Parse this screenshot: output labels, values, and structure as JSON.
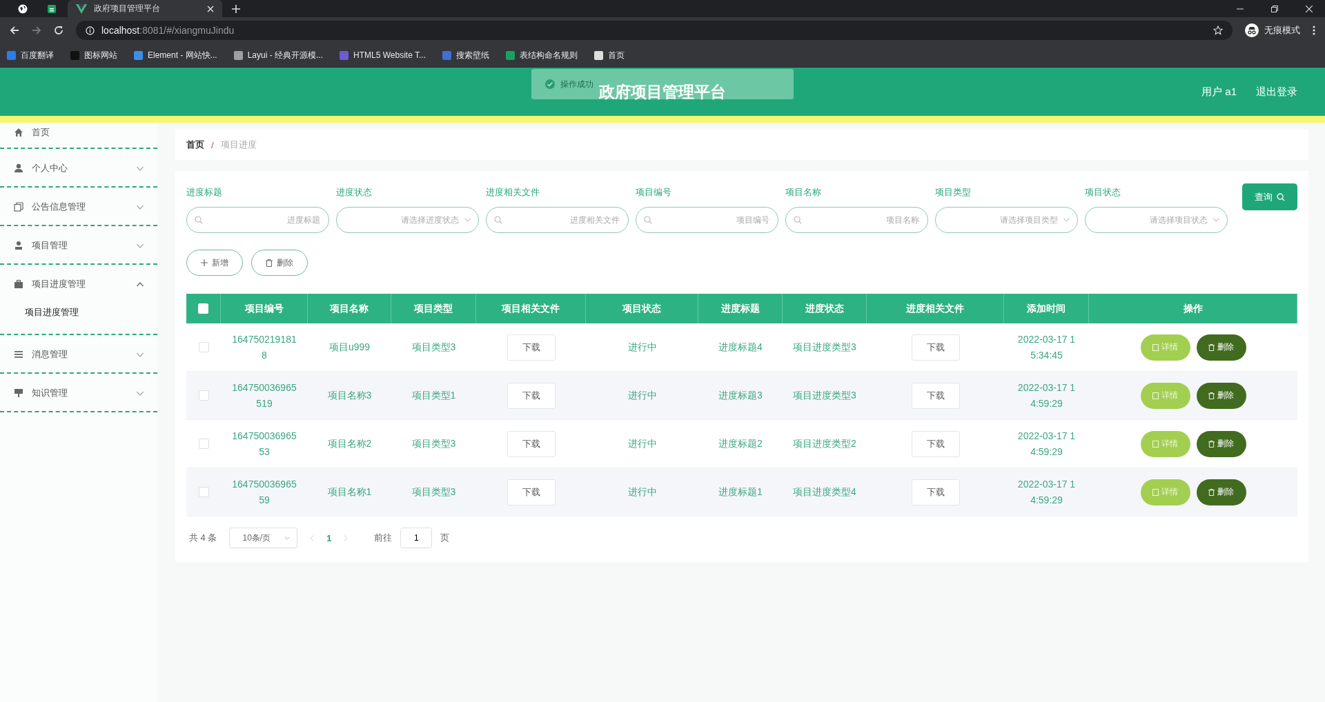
{
  "browser": {
    "tabs": [
      {
        "kind": "globe",
        "selected": false
      },
      {
        "kind": "sheet",
        "selected": false
      },
      {
        "kind": "vue",
        "title": "政府项目管理平台",
        "selected": true
      }
    ],
    "url_host": "localhost",
    "url_rest": ":8081/#/xiangmuJindu",
    "profile": "无痕模式",
    "bookmarks": [
      {
        "label": "百度翻译",
        "color": "#2b7de9"
      },
      {
        "label": "图标网站",
        "color": "#111111"
      },
      {
        "label": "Element - 网站快...",
        "color": "#3a8ee6"
      },
      {
        "label": "Layui - 经典开源模...",
        "color": "#9e9e9e"
      },
      {
        "label": "HTML5 Website T...",
        "color": "#6b5bd6"
      },
      {
        "label": "搜索壁纸",
        "color": "#3f6fd8"
      },
      {
        "label": "表结构命名规则",
        "color": "#1aa260"
      },
      {
        "label": "首页",
        "color": "#dddddd"
      }
    ]
  },
  "header": {
    "title": "政府项目管理平台",
    "user": "用户 a1",
    "logout": "退出登录",
    "toast": "操作成功"
  },
  "sidebar": {
    "items": [
      {
        "label": "首页"
      },
      {
        "label": "个人中心",
        "expanded": false
      },
      {
        "label": "公告信息管理",
        "expanded": false
      },
      {
        "label": "项目管理",
        "expanded": false
      },
      {
        "label": "项目进度管理",
        "expanded": true,
        "children": [
          {
            "label": "项目进度管理",
            "selected": true
          }
        ]
      },
      {
        "label": "消息管理",
        "expanded": false
      },
      {
        "label": "知识管理",
        "expanded": false
      }
    ]
  },
  "breadcrumb": {
    "home": "首页",
    "separator": "/",
    "current": "项目进度"
  },
  "search": {
    "fields": [
      {
        "kind": "text",
        "label": "进度标题",
        "placeholder": "进度标题"
      },
      {
        "kind": "select",
        "label": "进度状态",
        "placeholder": "请选择进度状态"
      },
      {
        "kind": "text",
        "label": "进度相关文件",
        "placeholder": "进度相关文件"
      },
      {
        "kind": "text",
        "label": "项目编号",
        "placeholder": "项目编号"
      },
      {
        "kind": "text",
        "label": "项目名称",
        "placeholder": "项目名称"
      },
      {
        "kind": "select",
        "label": "项目类型",
        "placeholder": "请选择项目类型"
      },
      {
        "kind": "select",
        "label": "项目状态",
        "placeholder": "请选择项目状态"
      }
    ],
    "query": "查询"
  },
  "actions": {
    "add": "新增",
    "delete": "删除"
  },
  "table": {
    "all_checked": false,
    "columns": [
      "项目编号",
      "项目名称",
      "项目类型",
      "项目相关文件",
      "项目状态",
      "进度标题",
      "进度状态",
      "进度相关文件",
      "添加时间",
      "操作"
    ],
    "rows": [
      {
        "checked": false,
        "id": "1647502191818",
        "name": "项目u999",
        "type": "项目类型3",
        "file": "下载",
        "status": "进行中",
        "title": "进度标题4",
        "progress": "项目进度类型3",
        "progress_file": "下载",
        "time": "2022-03-17 15:34:45",
        "details": "详情",
        "delete": "删除"
      },
      {
        "checked": false,
        "id": "164750036965519",
        "name": "项目名称3",
        "type": "项目类型1",
        "file": "下载",
        "status": "进行中",
        "title": "进度标题3",
        "progress": "项目进度类型3",
        "progress_file": "下载",
        "time": "2022-03-17 14:59:29",
        "details": "详情",
        "delete": "删除"
      },
      {
        "checked": false,
        "id": "16475003696553",
        "name": "项目名称2",
        "type": "项目类型3",
        "file": "下载",
        "status": "进行中",
        "title": "进度标题2",
        "progress": "项目进度类型2",
        "progress_file": "下载",
        "time": "2022-03-17 14:59:29",
        "details": "详情",
        "delete": "删除"
      },
      {
        "checked": false,
        "id": "16475003696559",
        "name": "项目名称1",
        "type": "项目类型3",
        "file": "下载",
        "status": "进行中",
        "title": "进度标题1",
        "progress": "项目进度类型4",
        "progress_file": "下载",
        "time": "2022-03-17 14:59:29",
        "details": "详情",
        "delete": "删除"
      }
    ]
  },
  "pagination": {
    "total": "共 4 条",
    "page_size": "10条/页",
    "pages": [
      {
        "label": "1",
        "selected": true
      }
    ],
    "goto": "前往",
    "goto_value": "1",
    "unit": "页"
  }
}
